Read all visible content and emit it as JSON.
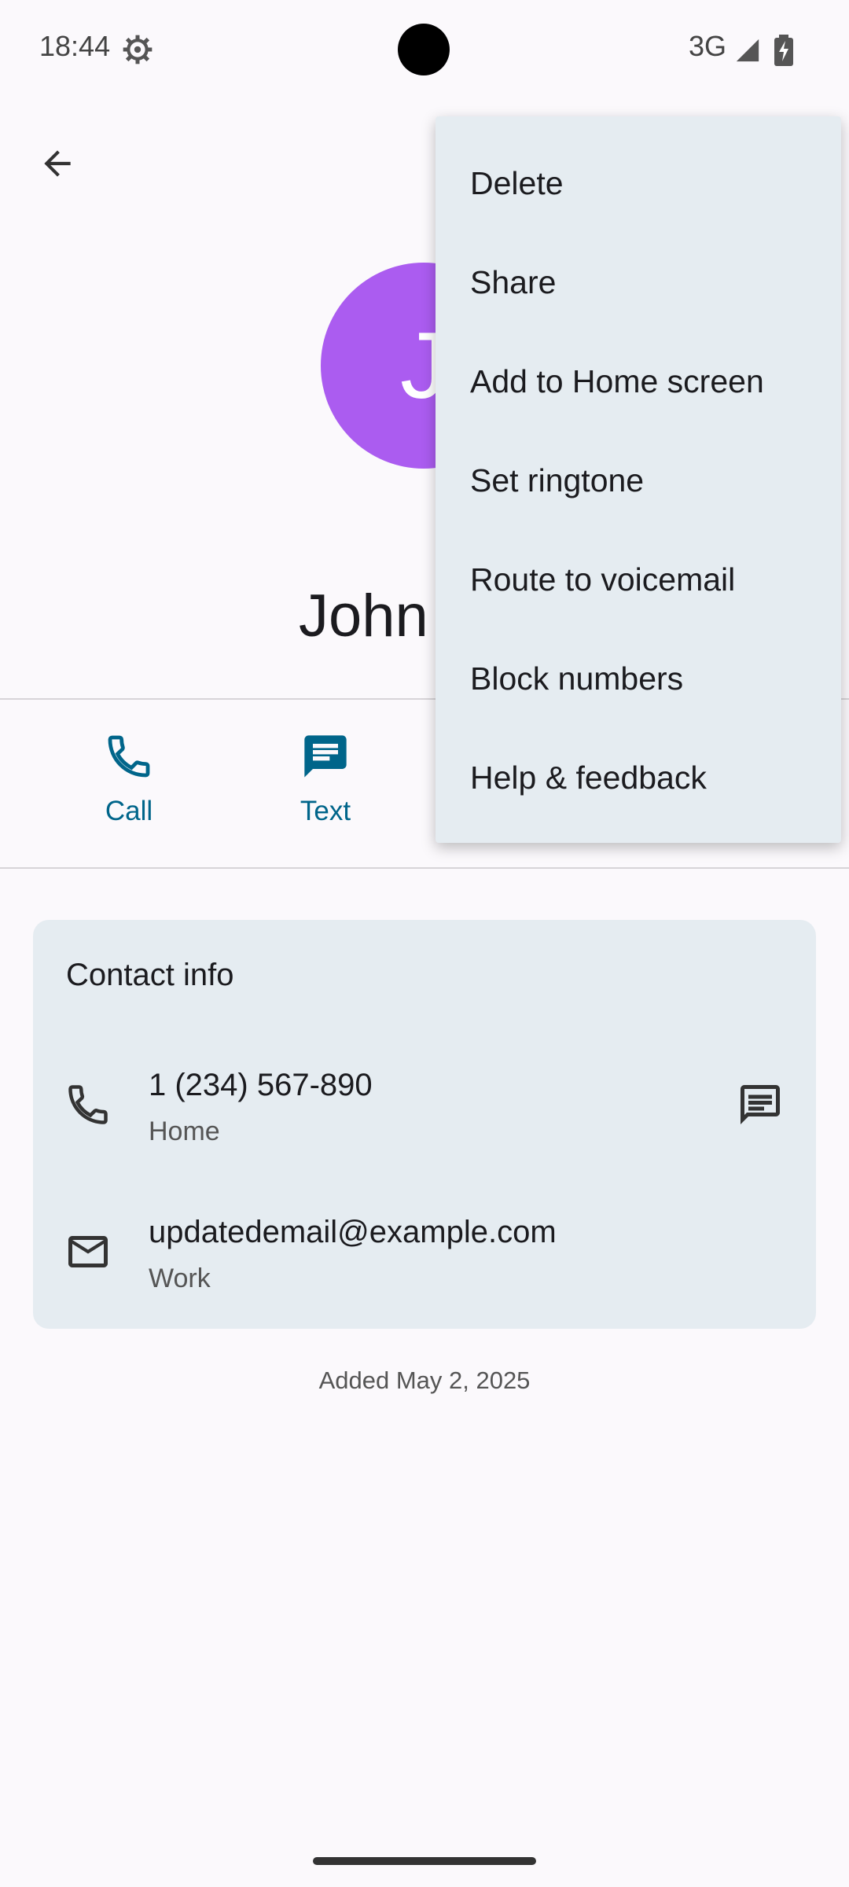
{
  "status_bar": {
    "time": "18:44",
    "network": "3G",
    "icons": [
      "gear-icon",
      "signal-icon",
      "battery-charging-icon"
    ]
  },
  "header": {
    "back_icon": "arrow-left-icon"
  },
  "contact": {
    "avatar_letter": "J",
    "avatar_color": "#ab5cf0",
    "name": "John"
  },
  "actions": [
    {
      "label": "Call",
      "icon": "phone-icon"
    },
    {
      "label": "Text",
      "icon": "message-icon"
    }
  ],
  "contact_info": {
    "title": "Contact info",
    "phone": {
      "number": "1 (234) 567-890",
      "type": "Home",
      "icon": "phone-icon",
      "action_icon": "message-icon"
    },
    "email": {
      "address": "updatedemail@example.com",
      "type": "Work",
      "icon": "mail-icon"
    }
  },
  "added": "Added May 2, 2025",
  "menu": {
    "items": [
      "Delete",
      "Share",
      "Add to Home screen",
      "Set ringtone",
      "Route to voicemail",
      "Block numbers",
      "Help & feedback"
    ]
  },
  "colors": {
    "accent": "#00658a",
    "card_bg": "#e5ecf1",
    "background": "#fbf9fc"
  }
}
